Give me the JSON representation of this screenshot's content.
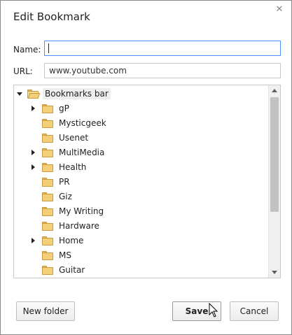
{
  "dialog": {
    "title": "Edit Bookmark",
    "close_icon": "close-icon"
  },
  "form": {
    "name_label": "Name:",
    "name_value": "",
    "url_label": "URL:",
    "url_value": "www.youtube.com"
  },
  "tree": {
    "root": {
      "label": "Bookmarks bar",
      "expanded": true,
      "selected": true,
      "icon": "folder-open-icon"
    },
    "items": [
      {
        "label": "gP",
        "has_children": true,
        "icon": "folder-icon"
      },
      {
        "label": "Mysticgeek",
        "has_children": false,
        "icon": "folder-icon"
      },
      {
        "label": "Usenet",
        "has_children": false,
        "icon": "folder-icon"
      },
      {
        "label": "MultiMedia",
        "has_children": true,
        "icon": "folder-icon"
      },
      {
        "label": "Health",
        "has_children": true,
        "icon": "folder-icon"
      },
      {
        "label": "PR",
        "has_children": false,
        "icon": "folder-icon"
      },
      {
        "label": "Giz",
        "has_children": false,
        "icon": "folder-icon"
      },
      {
        "label": "My Writing",
        "has_children": false,
        "icon": "folder-icon"
      },
      {
        "label": "Hardware",
        "has_children": false,
        "icon": "folder-icon"
      },
      {
        "label": "Home",
        "has_children": true,
        "icon": "folder-icon"
      },
      {
        "label": "MS",
        "has_children": false,
        "icon": "folder-icon"
      },
      {
        "label": "Guitar",
        "has_children": false,
        "icon": "folder-icon"
      }
    ]
  },
  "buttons": {
    "new_folder": "New folder",
    "save": "Save",
    "cancel": "Cancel"
  },
  "colors": {
    "focus_border": "#4d90fe",
    "folder_fill": "#f4cf7a",
    "selection_bg": "#eeeeee"
  }
}
